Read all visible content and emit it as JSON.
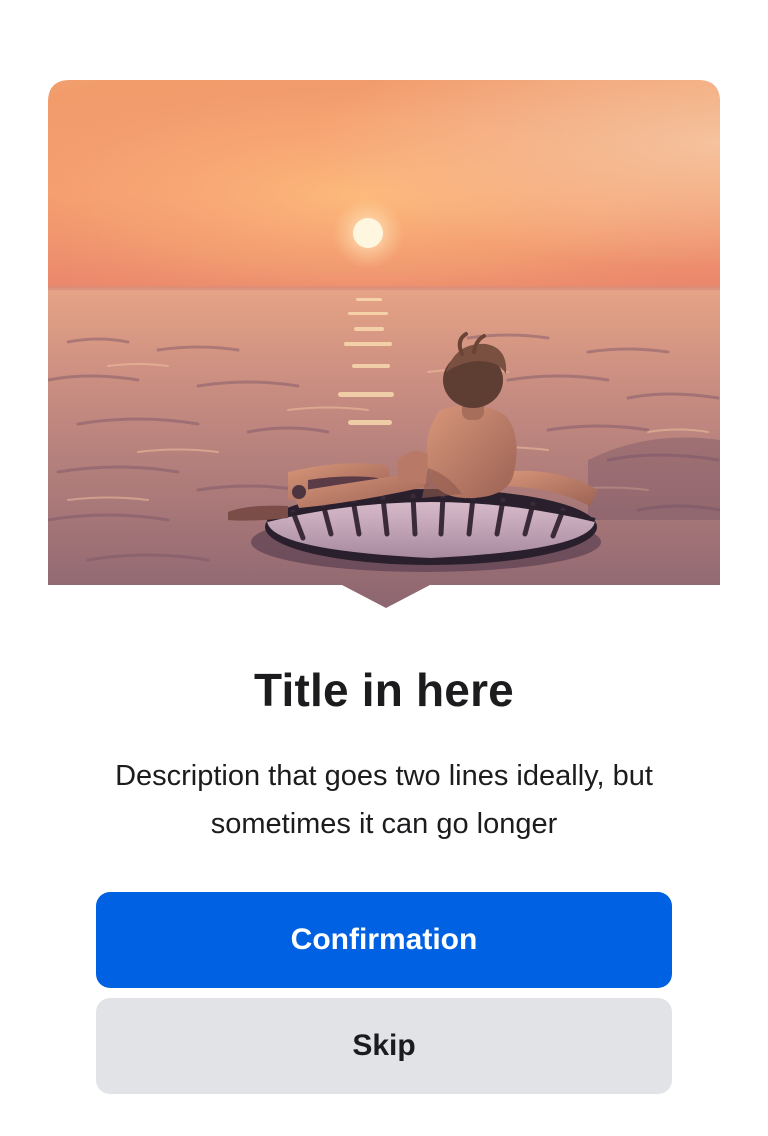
{
  "card": {
    "title": "Title in here",
    "description": "Description that goes two lines ideally, but sometimes it can go longer"
  },
  "actions": {
    "primary_label": "Confirmation",
    "secondary_label": "Skip"
  },
  "hero": {
    "alt": "Person floating on an inflatable ring in the sea at sunset"
  },
  "colors": {
    "primary": "#0062e3",
    "secondary": "#e1e3e6",
    "text": "#1c1c1e"
  }
}
